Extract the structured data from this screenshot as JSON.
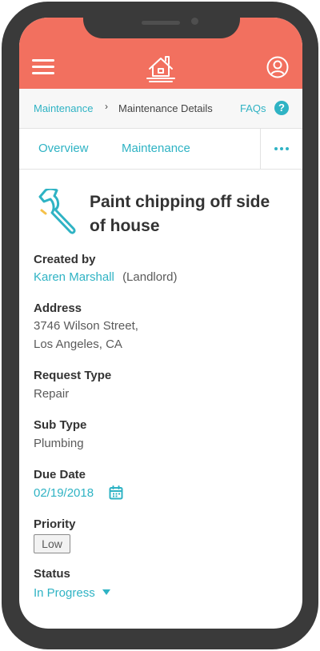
{
  "header": {
    "menu_icon": "hamburger-menu-icon",
    "logo_icon": "house-logo-icon",
    "profile_icon": "user-profile-icon",
    "color": "#f2705f"
  },
  "breadcrumb": {
    "parent": "Maintenance",
    "separator": "›",
    "current": "Maintenance Details",
    "faq_label": "FAQs",
    "faq_icon": "?"
  },
  "tabs": {
    "items": [
      "Overview",
      "Maintenance"
    ],
    "more_icon": "more-dots-icon"
  },
  "request": {
    "title": "Paint chipping off side of house",
    "icon": "wrench-icon",
    "fields": {
      "created_by_label": "Created by",
      "created_by_name": "Karen Marshall",
      "created_by_role": "(Landlord)",
      "address_label": "Address",
      "address_line1": "3746 Wilson Street,",
      "address_line2": "Los Angeles, CA",
      "request_type_label": "Request Type",
      "request_type": "Repair",
      "sub_type_label": "Sub Type",
      "sub_type": "Plumbing",
      "due_date_label": "Due Date",
      "due_date": "02/19/2018",
      "priority_label": "Priority",
      "priority": "Low",
      "status_label": "Status",
      "status": "In Progress"
    }
  },
  "colors": {
    "accent": "#2fb3c4",
    "header": "#f2705f",
    "frame": "#3a3a3a"
  }
}
